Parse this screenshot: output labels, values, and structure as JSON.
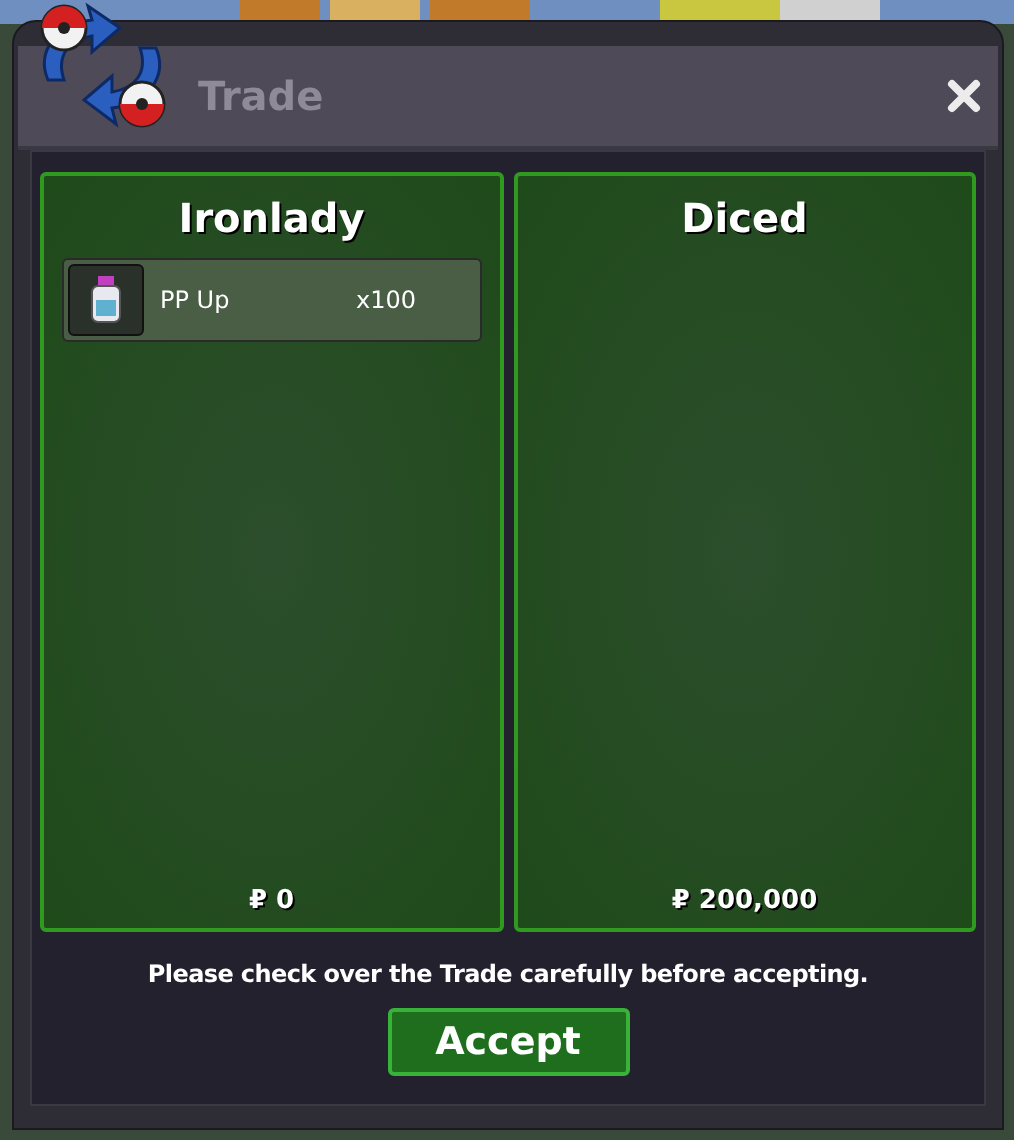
{
  "window": {
    "title": "Trade"
  },
  "panels": [
    {
      "player": "Ironlady",
      "items": [
        {
          "name": "PP Up",
          "quantity": "x100"
        }
      ],
      "money": "₽ 0"
    },
    {
      "player": "Diced",
      "money": "₽ 200,000"
    }
  ],
  "message": "Please check over the Trade carefully before accepting.",
  "accept_button": "Accept"
}
